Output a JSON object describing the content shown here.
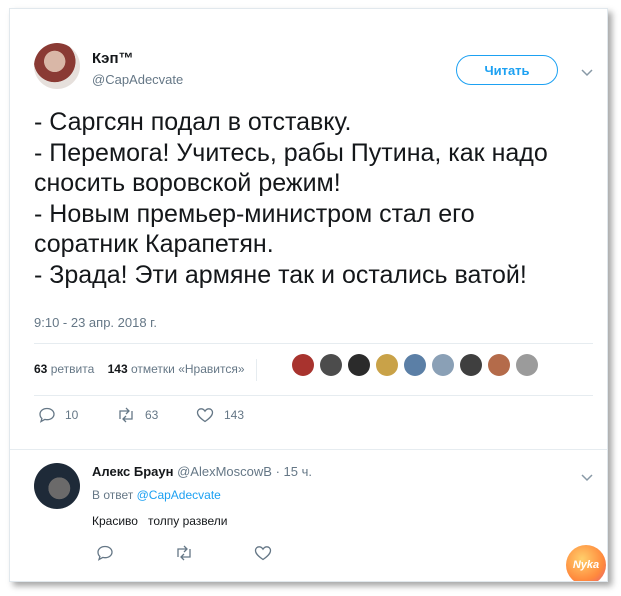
{
  "tweet": {
    "author_name": "Кэп™",
    "author_handle": "@CapAdecvate",
    "follow_label": "Читать",
    "lines": [
      "- Саргсян подал в отставку.",
      "- Перемога! Учитесь, рабы Путина, как надо",
      "сносить воровской режим!",
      "- Новым премьер-министром стал его",
      "соратник Карапетян.",
      "- Зрада! Эти армяне так и остались ватой!"
    ],
    "timestamp": "9:10 - 23 апр. 2018 г.",
    "retweets_count": "63",
    "retweets_label": "ретвита",
    "likes_count": "143",
    "likes_label": "отметки «Нравится»",
    "actions": {
      "replies": "10",
      "retweets": "63",
      "likes": "143"
    }
  },
  "likers_colors": [
    "#a8332e",
    "#4c4c4c",
    "#2b2b2b",
    "#c9a248",
    "#5b7fa6",
    "#8aa0b6",
    "#3f3f3f",
    "#b46b4a",
    "#9b9b9b"
  ],
  "reply": {
    "author_name": "Алекс Браун",
    "author_handle": "@AlexMoscowB",
    "time": "· 15 ч.",
    "in_reply_prefix": "В ответ",
    "in_reply_handle": "@CapAdecvate",
    "text": "Красиво   толпу развели"
  },
  "watermark": "Nyka",
  "colors": {
    "accent": "#1da1f2",
    "muted": "#657786",
    "text": "#14171a",
    "border": "#e6ecf0"
  }
}
